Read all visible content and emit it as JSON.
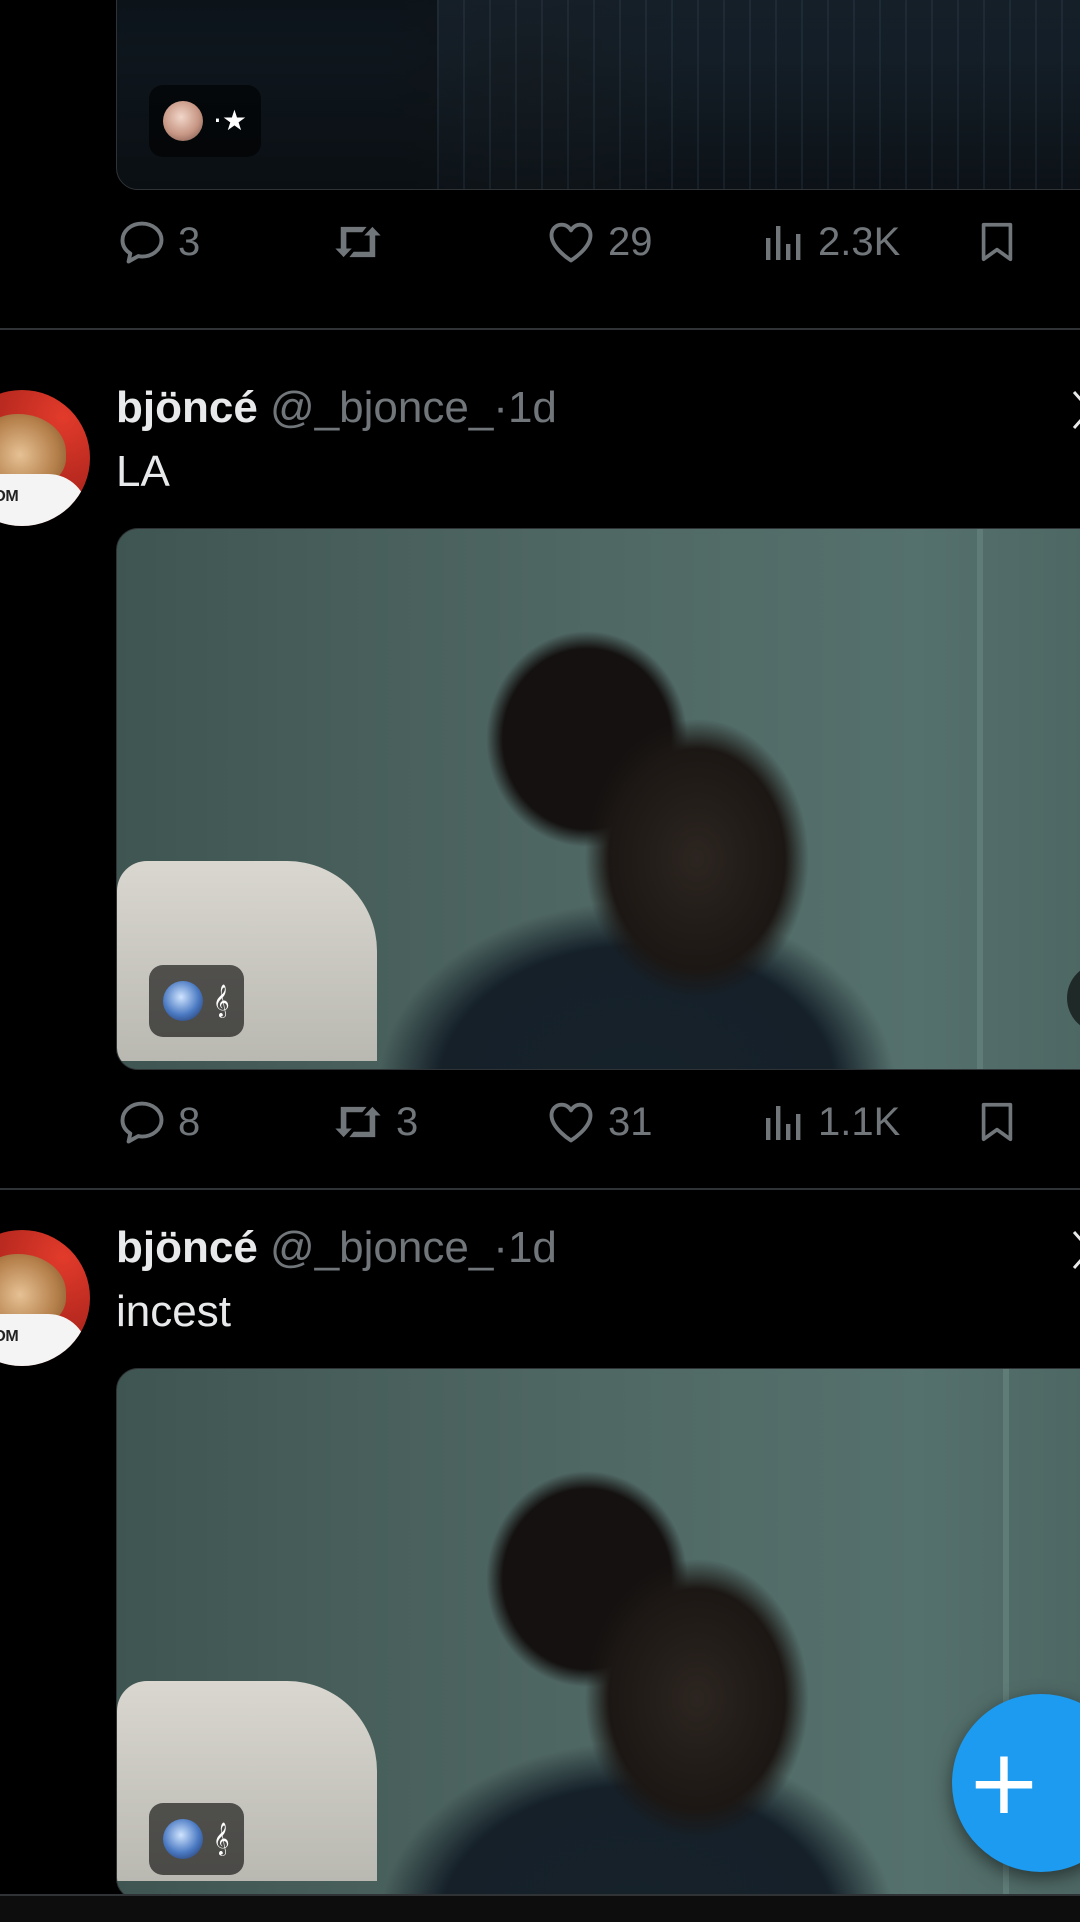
{
  "tweets": [
    {
      "badge_text": "·★",
      "stats": {
        "replies": "3",
        "retweets": "",
        "likes": "29",
        "views": "2.3K"
      }
    },
    {
      "author_name": "bjöncé",
      "handle": "@_bjonce_",
      "separator": "·",
      "time": "1d",
      "text": "LA",
      "badge_text": "𝄞",
      "avatar_shirt_text": "EEDOM",
      "stats": {
        "replies": "8",
        "retweets": "3",
        "likes": "31",
        "views": "1.1K"
      }
    },
    {
      "author_name": "bjöncé",
      "handle": "@_bjonce_",
      "separator": "·",
      "time": "1d",
      "text": "incest",
      "badge_text": "𝄞",
      "avatar_shirt_text": "EEDOM"
    }
  ],
  "fab": {
    "label": "+",
    "color": "#1d9bf0"
  },
  "colors": {
    "background": "#000000",
    "muted": "#71767b",
    "text": "#e7e9ea",
    "divider": "#2f3336"
  }
}
